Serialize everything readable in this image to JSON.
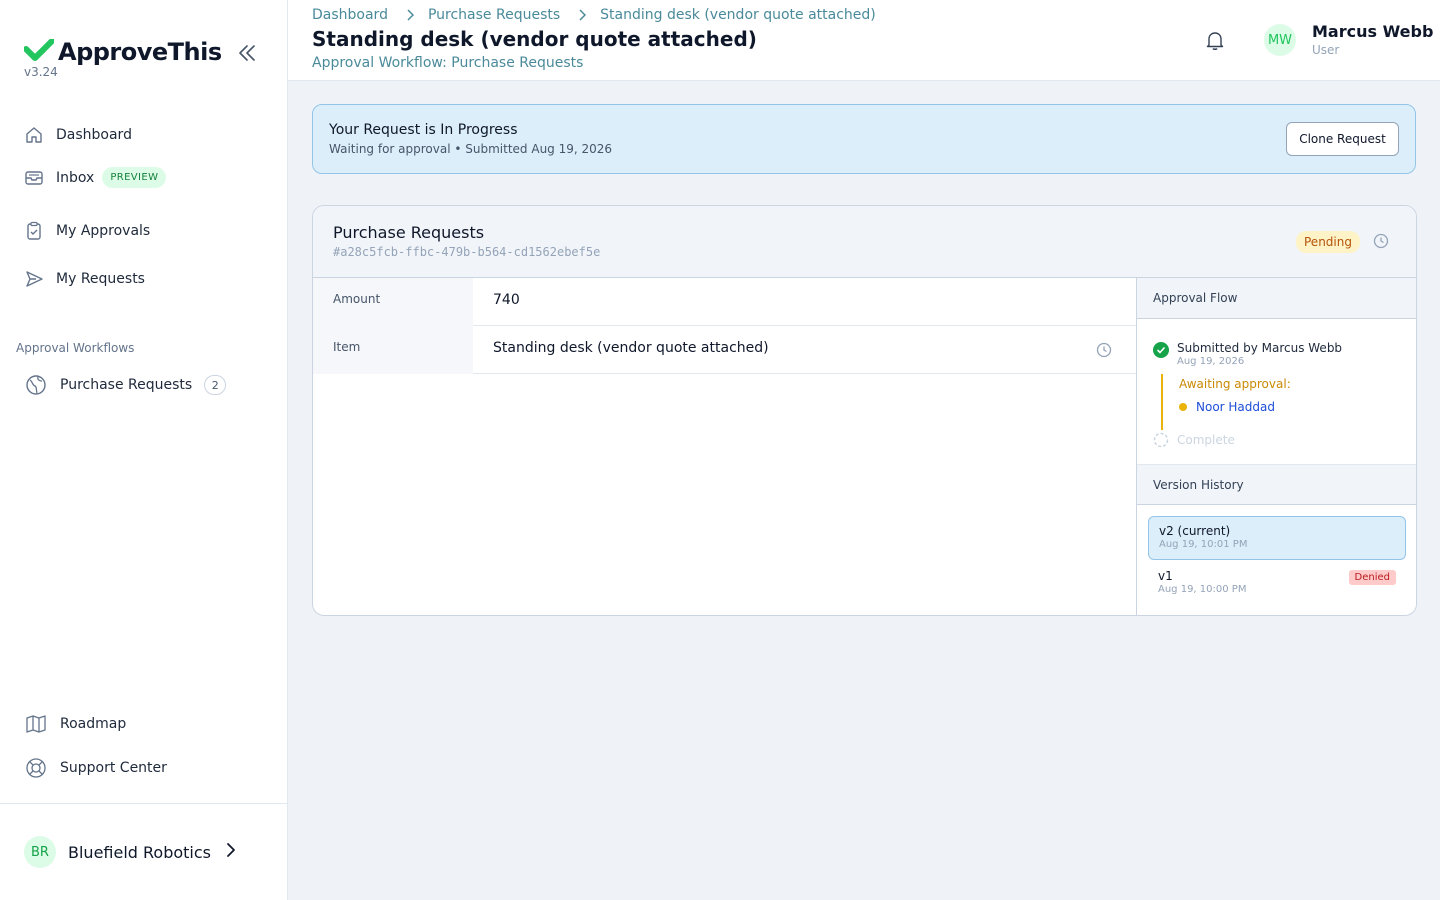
{
  "app": {
    "name": "ApproveThis",
    "version": "v3.24"
  },
  "sidebar": {
    "items": [
      {
        "label": "Dashboard",
        "icon": "home-icon"
      },
      {
        "label": "Inbox",
        "icon": "inbox-icon",
        "badge": "PREVIEW"
      },
      {
        "label": "My Approvals",
        "icon": "clipboard-check-icon"
      },
      {
        "label": "My Requests",
        "icon": "send-icon"
      }
    ],
    "section_label": "Approval Workflows",
    "workflows": [
      {
        "label": "Purchase Requests",
        "count": "2",
        "icon": "globe-icon"
      }
    ],
    "bottom_items": [
      {
        "label": "Roadmap",
        "icon": "map-icon"
      },
      {
        "label": "Support Center",
        "icon": "life-buoy-icon"
      }
    ],
    "org": {
      "initials": "BR",
      "name": "Bluefield Robotics"
    }
  },
  "header": {
    "breadcrumb": [
      "Dashboard",
      "Purchase Requests",
      "Standing desk (vendor quote attached)"
    ],
    "title": "Standing desk (vendor quote attached)",
    "subtitle": "Approval Workflow: Purchase Requests",
    "user": {
      "initials": "MW",
      "name": "Marcus Webb",
      "role": "User"
    }
  },
  "banner": {
    "title": "Your Request is In Progress",
    "subtitle": "Waiting for approval • Submitted Aug 19, 2026",
    "button": "Clone Request"
  },
  "request": {
    "title": "Purchase Requests",
    "id": "#a28c5fcb-ffbc-479b-b564-cd1562ebef5e",
    "status": "Pending",
    "fields": [
      {
        "label": "Amount",
        "value": "740"
      },
      {
        "label": "Item",
        "value": "Standing desk (vendor quote attached)"
      }
    ]
  },
  "approval_flow": {
    "heading": "Approval Flow",
    "submitted_by": "Submitted by Marcus Webb",
    "submitted_date": "Aug 19, 2026",
    "awaiting_label": "Awaiting approval:",
    "approver": "Noor Haddad",
    "complete_label": "Complete"
  },
  "version_history": {
    "heading": "Version History",
    "versions": [
      {
        "label": "v2 (current)",
        "date": "Aug 19, 10:01 PM",
        "badge": ""
      },
      {
        "label": "v1",
        "date": "Aug 19, 10:00 PM",
        "badge": "Denied"
      }
    ]
  },
  "colors": {
    "brand_green": "#22c55e",
    "link_teal": "#4a8a9a",
    "banner_bg": "#dceefa",
    "pending": "#b45309",
    "denied": "#b91c1c"
  }
}
